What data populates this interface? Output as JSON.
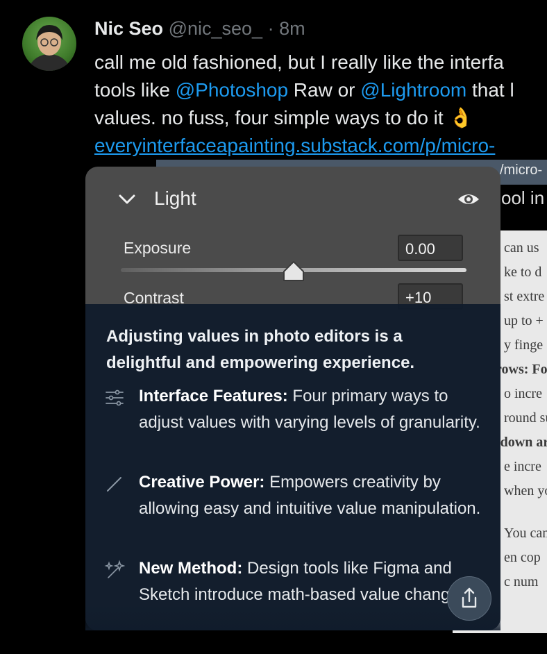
{
  "tweet": {
    "author": "Nic Seo",
    "handle": "@nic_seo_",
    "separator": "·",
    "time": "8m",
    "line1": "call me old fashioned, but I really like the interfa",
    "line2_pre": "tools like ",
    "mention1": "@Photoshop",
    "line2_mid": " Raw or ",
    "mention2": "@Lightroom",
    "line2_post": " that l",
    "line3": "values. no fuss, four simple ways to do it ",
    "emoji": "👌",
    "link": "everyinterfaceapainting.substack.com/p/micro-"
  },
  "background": {
    "strip_text": "/micro-",
    "title_fragment": "ool in",
    "article_lines": [
      {
        "text": "can us",
        "bold": false
      },
      {
        "text": "ke to d",
        "bold": false
      },
      {
        "text": "st extre",
        "bold": false
      },
      {
        "text": "up to +",
        "bold": false
      },
      {
        "text": "y finge",
        "bold": false
      },
      {
        "text": "rows: Focu",
        "bold": true
      },
      {
        "text": "o incre",
        "bold": false
      },
      {
        "text": "round su",
        "bold": false
      },
      {
        "text": "-down arrov",
        "bold": true
      },
      {
        "text": "e incre",
        "bold": false
      },
      {
        "text": "when you h",
        "bold": false
      },
      {
        "text": "You can also",
        "bold": false
      },
      {
        "text": "en cop",
        "bold": false
      },
      {
        "text": "c num",
        "bold": false
      }
    ]
  },
  "panel": {
    "title": "Light",
    "sliders": [
      {
        "label": "Exposure",
        "value": "0.00",
        "position": 0.5
      },
      {
        "label": "Contrast",
        "value": "+10"
      }
    ]
  },
  "overlay": {
    "summary": "Adjusting values in photo editors is a delightful and empowering experience.",
    "features": [
      {
        "icon": "sliders-icon",
        "title": "Interface Features:",
        "text": " Four primary ways to adjust values with varying levels of granularity."
      },
      {
        "icon": "pencil-icon",
        "title": "Creative Power:",
        "text": " Empowers creativity by allowing easy and intuitive value manipulation."
      },
      {
        "icon": "sparkles-icon",
        "title": "New Method:",
        "text": " Design tools like Figma and Sketch introduce math-based value changing."
      }
    ],
    "share_icon": "share-icon"
  },
  "colors": {
    "link": "#1d9bf0",
    "overlay": "#101c2c",
    "panel": "#4b4b4b"
  }
}
